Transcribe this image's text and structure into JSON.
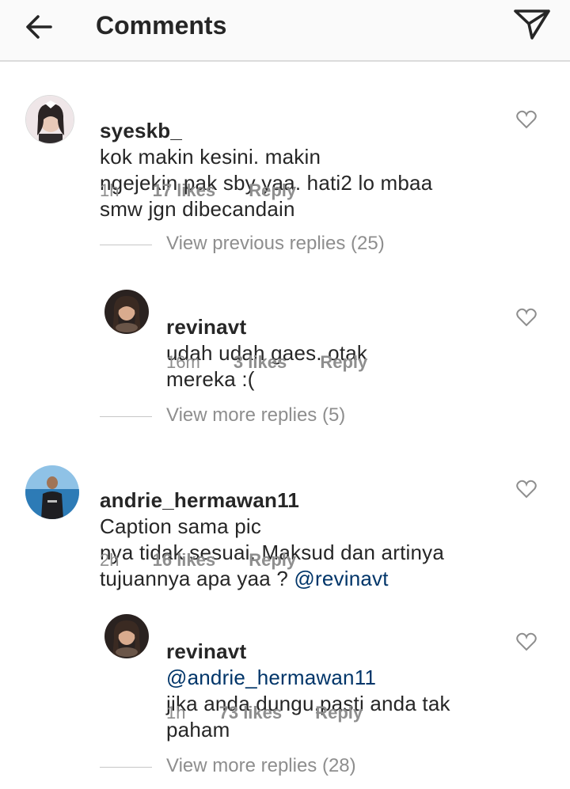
{
  "header": {
    "title": "Comments",
    "back_icon": "arrow-left-icon",
    "send_icon": "paper-plane-icon"
  },
  "comments": [
    {
      "username": "syeskb_",
      "text": "kok makin kesini. makin\nngejekin pak sby yaa. hati2 lo mbaa\nsmw jgn dibecandain",
      "time": "1h",
      "likes": "17 likes",
      "reply": "Reply"
    }
  ],
  "replies_links": [
    "View previous replies (25)",
    "View more replies (5)",
    "View more replies (28)"
  ],
  "replies": [
    {
      "username": "revinavt",
      "text": "udah udah gaes. otak\nmereka :(",
      "time": "16m",
      "likes": "3 likes",
      "reply": "Reply"
    },
    {
      "username": "revinavt",
      "mention": "@andrie_hermawan11",
      "text": "jika anda dungu,pasti anda tak\npaham",
      "time": "1h",
      "likes": "73 likes",
      "reply": "Reply"
    }
  ],
  "comment2": {
    "username": "andrie_hermawan11",
    "text": "Caption sama pic\nnya tidak sesuai..Maksud dan artinya\ntujuannya apa yaa ? ",
    "mention": "@revinavt",
    "time": "2h",
    "likes": "16 likes",
    "reply": "Reply"
  },
  "colors": {
    "text": "#262626",
    "meta": "#8e8e8e",
    "mention": "#003569",
    "header_bg": "#fafafa"
  }
}
